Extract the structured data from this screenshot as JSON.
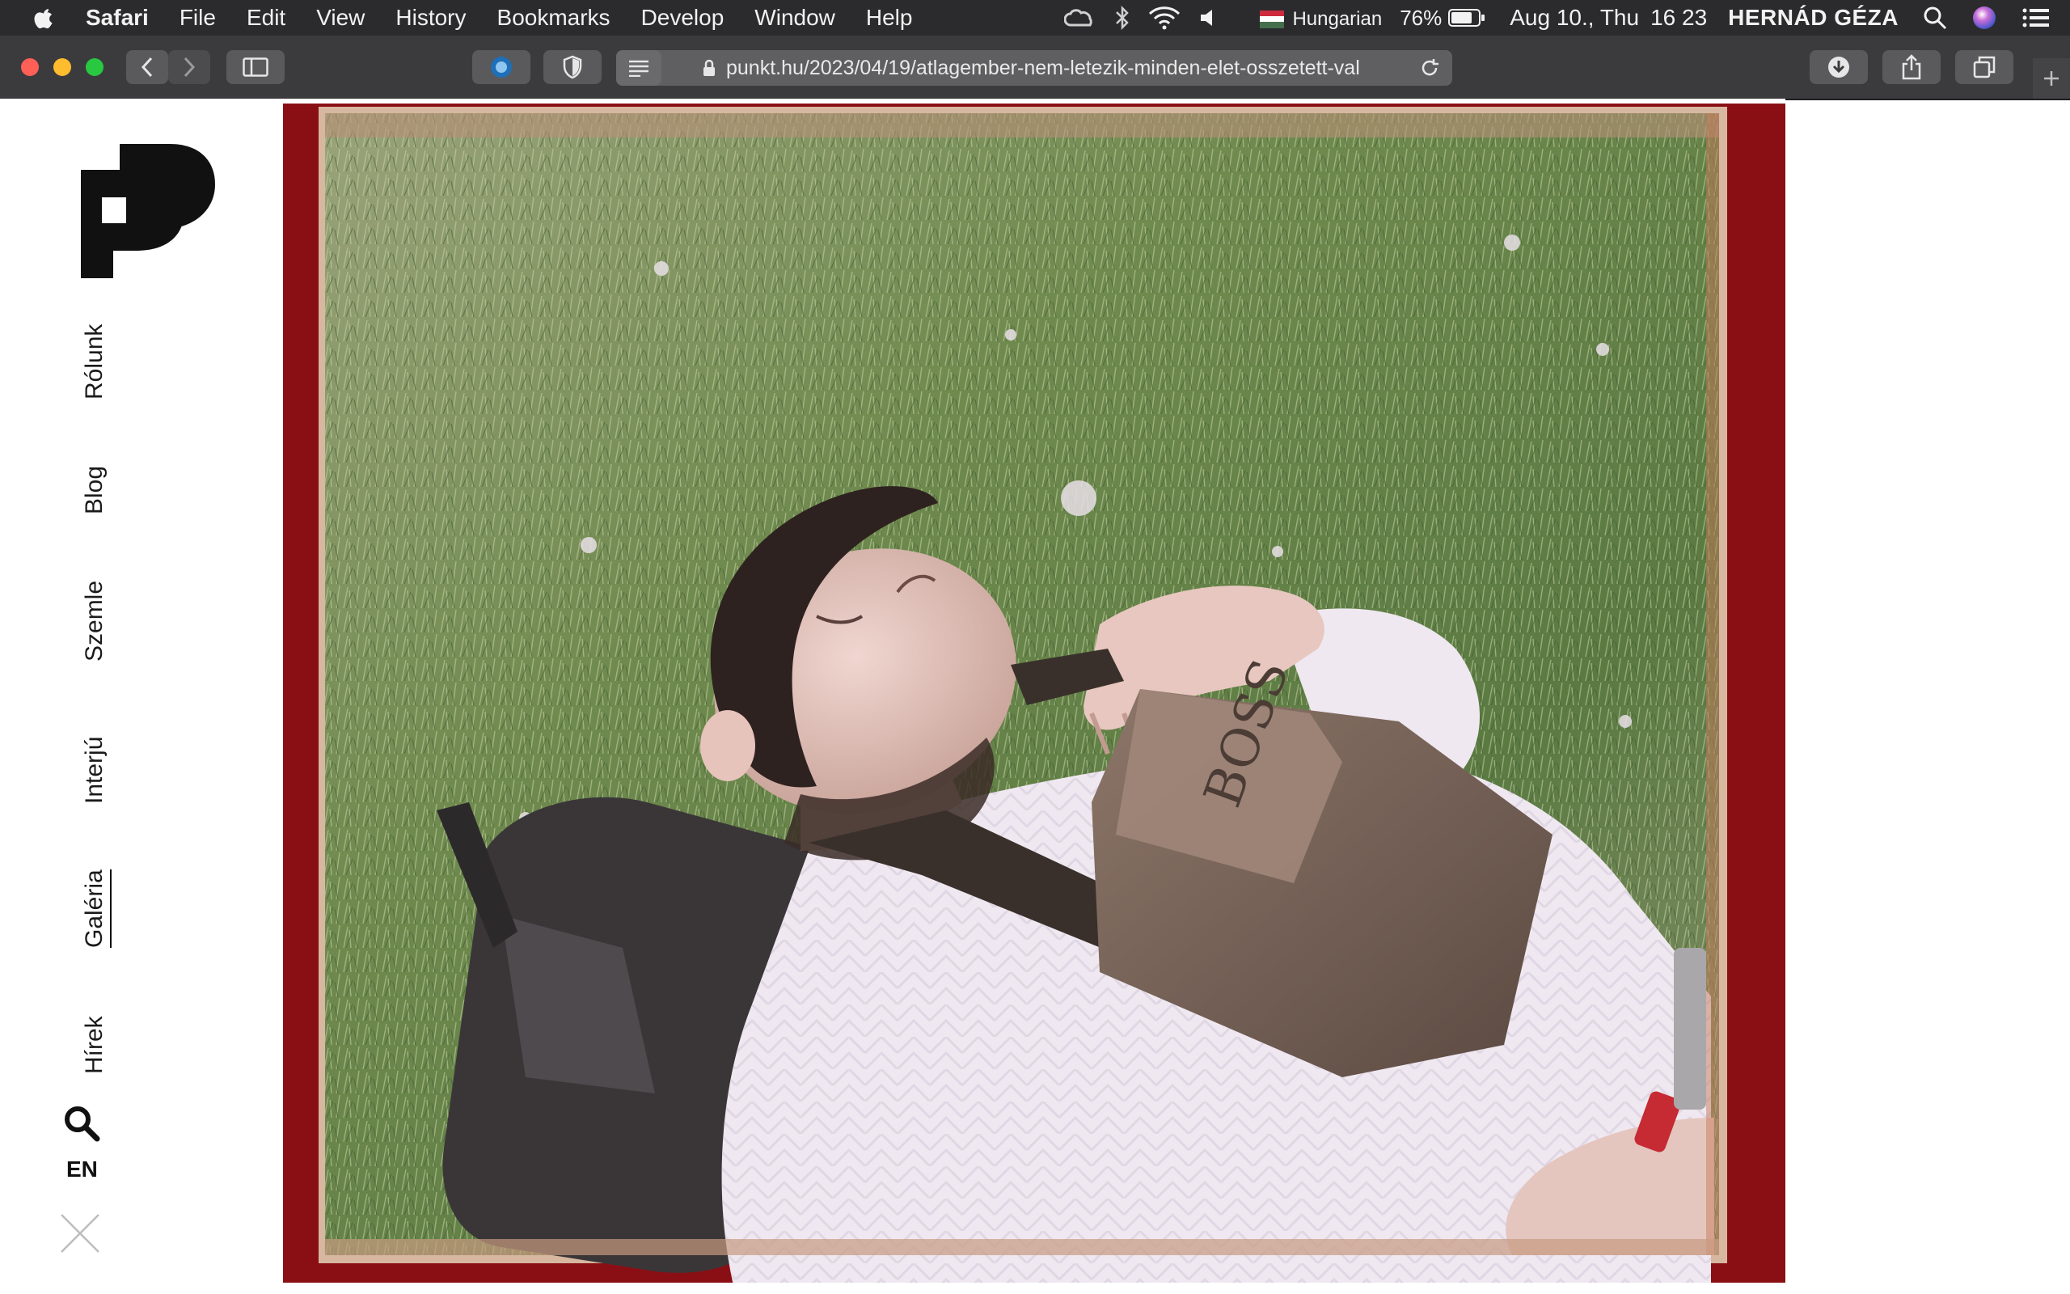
{
  "menubar": {
    "app_name": "Safari",
    "items": [
      "File",
      "Edit",
      "View",
      "History",
      "Bookmarks",
      "Develop",
      "Window",
      "Help"
    ],
    "keyboard_layout": "Hungarian",
    "battery": "76%",
    "date": "Aug 10., Thu",
    "time": "16 23",
    "user": "HERNÁD GÉZA"
  },
  "browser": {
    "url": "punkt.hu/2023/04/19/atlagember-nem-letezik-minden-elet-osszetett-val"
  },
  "sidebar": {
    "nav": [
      "Rólunk",
      "Blog",
      "Szemle",
      "Interjú",
      "Galéria",
      "Hírek"
    ],
    "active": "Galéria",
    "language_toggle": "EN"
  },
  "icons": {
    "logo": "punkt-logo",
    "search": "search-icon",
    "close": "close-icon"
  },
  "colors": {
    "menubar_bg": "#2b2b2d",
    "toolbar_bg": "#3b3b3d",
    "film_border": "#8a0f14",
    "grass": "#6f8a4e"
  }
}
